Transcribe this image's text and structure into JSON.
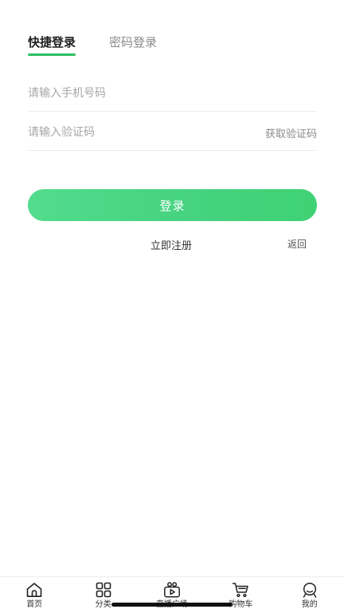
{
  "tabs": {
    "quick_login": "快捷登录",
    "password_login": "密码登录"
  },
  "form": {
    "phone_placeholder": "请输入手机号码",
    "code_placeholder": "请输入验证码",
    "get_code_label": "获取验证码",
    "login_label": "登录"
  },
  "links": {
    "register_label": "立即注册",
    "back_label": "返回"
  },
  "bottom_nav": {
    "home": "首页",
    "category": "分类",
    "live": "直播广场",
    "cart": "购物车",
    "me": "我的"
  },
  "colors": {
    "accent": "#2dbf64",
    "button": "#45d37f"
  },
  "icons": [
    "home-icon",
    "category-grid-icon",
    "live-tv-icon",
    "cart-icon",
    "profile-icon"
  ]
}
